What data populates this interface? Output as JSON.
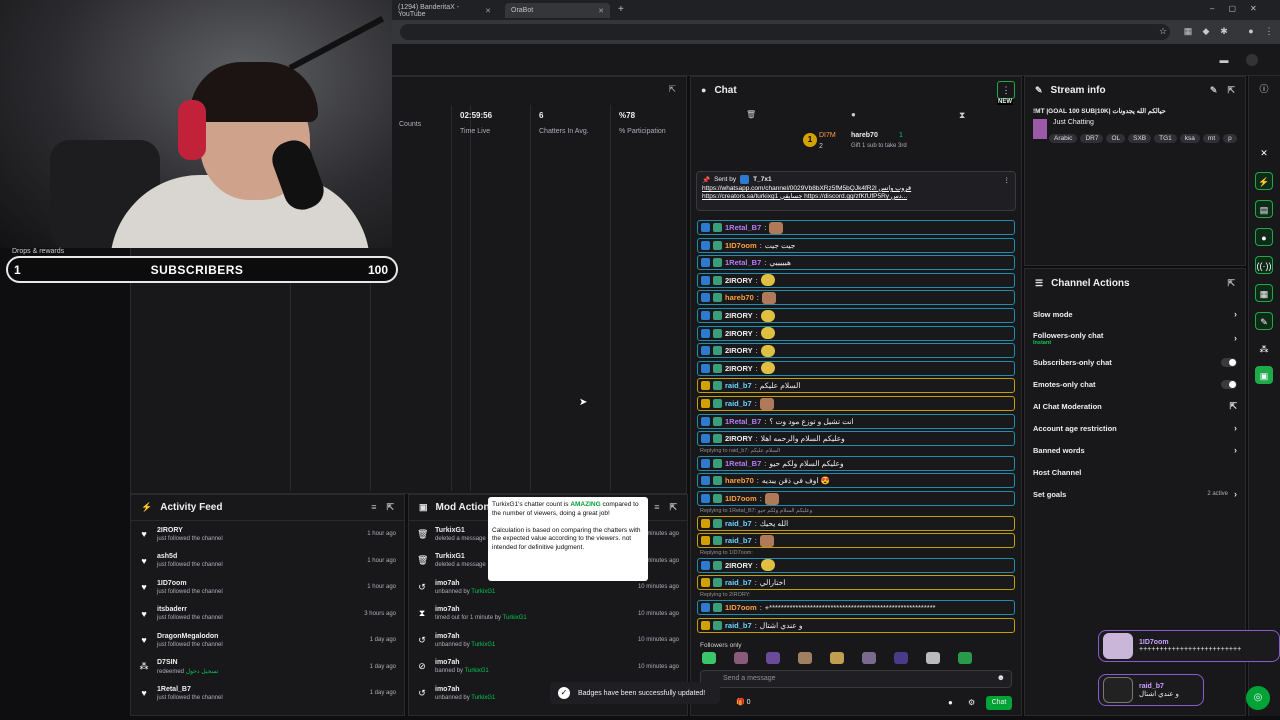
{
  "browser": {
    "tabs": [
      {
        "label": "(1294) BanderitaX - YouTube"
      },
      {
        "label": "OraBot"
      }
    ],
    "new_tab": "+"
  },
  "overlay": {
    "drops_label": "Drops & rewards",
    "goal_left": "1",
    "goal_title": "SUBSCRIBERS",
    "goal_right": "100"
  },
  "stats": {
    "columns": [
      {
        "value": "",
        "label": "Counts"
      },
      {
        "value": "02:59:56",
        "label": "Time Live"
      },
      {
        "value": "6",
        "label": "Chatters In Avg."
      },
      {
        "value": "%78",
        "label": "% Participation"
      }
    ]
  },
  "activity": {
    "title": "Activity Feed",
    "items": [
      {
        "icon": "heart-icon",
        "name": "2IRORY",
        "sub": "just followed the channel",
        "time": "1 hour ago"
      },
      {
        "icon": "heart-icon",
        "name": "ash5d",
        "sub": "just followed the channel",
        "time": "1 hour ago"
      },
      {
        "icon": "heart-icon",
        "name": "1ID7oom",
        "sub": "just followed the channel",
        "time": "1 hour ago"
      },
      {
        "icon": "heart-icon",
        "name": "itsbaderr",
        "sub": "just followed the channel",
        "time": "3 hours ago"
      },
      {
        "icon": "heart-icon",
        "name": "DragonMegalodon",
        "sub": "just followed the channel",
        "time": "1 day ago"
      },
      {
        "icon": "gift-icon",
        "name": "D7SIN",
        "sub": "redeemed",
        "sub2": "تسجيل دخول",
        "time": "1 day ago"
      },
      {
        "icon": "heart-icon",
        "name": "1Retal_B7",
        "sub": "just followed the channel",
        "time": "1 day ago"
      }
    ]
  },
  "mod": {
    "title": "Mod Action",
    "items": [
      {
        "icon": "trash-icon",
        "name": "TurkixG1",
        "sub": "deleted a message",
        "by": "",
        "time": "minutes ago"
      },
      {
        "icon": "trash-icon",
        "name": "TurkixG1",
        "sub": "deleted a message",
        "by": "",
        "time": "minutes ago"
      },
      {
        "icon": "undo-icon",
        "name": "imo7ah",
        "sub": "unbanned by",
        "by": "TurkixG1",
        "time": "10 minutes ago"
      },
      {
        "icon": "hourglass-icon",
        "name": "imo7ah",
        "sub": "timed out for 1 minute by",
        "by": "TurkixG1",
        "time": "10 minutes ago"
      },
      {
        "icon": "undo-icon",
        "name": "imo7ah",
        "sub": "unbanned by",
        "by": "TurkixG1",
        "time": "10 minutes ago"
      },
      {
        "icon": "ban-icon",
        "name": "imo7ah",
        "sub": "banned by",
        "by": "TurkixG1",
        "time": "10 minutes ago"
      },
      {
        "icon": "undo-icon",
        "name": "imo7ah",
        "sub": "unbanned by",
        "by": "TurkixG1",
        "time": "10 minutes ago"
      }
    ],
    "tooltip_p1_a": "TurkixG1's chatter count is ",
    "tooltip_p1_b": "AMAZING",
    "tooltip_p1_c": " compared to the number of viewers, doing a great job!",
    "tooltip_p2": "Calculation is based on comparing the chatters with the expected value according to the viewers. not intended for definitive judgment."
  },
  "chat": {
    "title": "Chat",
    "new_badge": "NEW",
    "leader_1": "DI7M",
    "leader_1_count": "2",
    "leader_2": "hareb70",
    "leader_2_count": "1",
    "leader_sub": "Gift 1 sub to take 3rd",
    "pinned_by": "Sent by",
    "pinned_user": "T_7x1",
    "pinned_line1": "https://whatsapp.com/channel/0029Vb8bXRz5fM5bQJk4fR2l قروب واتس",
    "pinned_line2": "https://creators.sa/turkixg1 جسابقي https://discord.gg/zfKfUfP5Ry دس...",
    "messages": [
      {
        "user": "1Retal_B7",
        "color": "#b77cf5",
        "text": "",
        "vip": false,
        "emote": true
      },
      {
        "user": "1ID7oom",
        "color": "#ff9f40",
        "text": "جيت جيت",
        "vip": false
      },
      {
        "user": "1Retal_B7",
        "color": "#b77cf5",
        "text": "هيييييي",
        "vip": false
      },
      {
        "user": "2IRORY",
        "color": "#efeff1",
        "text": "",
        "vip": false,
        "smile": true
      },
      {
        "user": "hareb70",
        "color": "#ff9f40",
        "text": "",
        "vip": false,
        "emote": true
      },
      {
        "user": "2IRORY",
        "color": "#efeff1",
        "text": "",
        "vip": false,
        "smile": true
      },
      {
        "user": "2IRORY",
        "color": "#efeff1",
        "text": "",
        "vip": false,
        "smile": true
      },
      {
        "user": "2IRORY",
        "color": "#efeff1",
        "text": "",
        "vip": false,
        "smile": true
      },
      {
        "user": "2IRORY",
        "color": "#efeff1",
        "text": "",
        "vip": false,
        "smile": true
      },
      {
        "user": "raid_b7",
        "color": "#6fd3ff",
        "text": "السلام عليكم",
        "vip": true
      },
      {
        "user": "raid_b7",
        "color": "#6fd3ff",
        "text": "",
        "vip": true,
        "emote": true
      },
      {
        "user": "1Retal_B7",
        "color": "#b77cf5",
        "text": "انت تشيل و توزع مود وت ؟",
        "vip": false
      },
      {
        "user": "2IRORY",
        "color": "#efeff1",
        "text": "وعليكم السلام والرحمه اهلا",
        "vip": false
      },
      {
        "user": "1Retal_B7",
        "color": "#b77cf5",
        "text": "وعليكم السلام ولكم حيو",
        "vip": false,
        "reply": "Replying to raid_b7: السلام عليكم"
      },
      {
        "user": "hareb70",
        "color": "#ff9f40",
        "text": "اوف في ذقن يبديه 😍",
        "vip": false
      },
      {
        "user": "1ID7oom",
        "color": "#ff9f40",
        "text": "",
        "vip": false,
        "emote": true
      },
      {
        "user": "raid_b7",
        "color": "#6fd3ff",
        "text": "الله يحيك",
        "vip": true,
        "reply": "Replying to 1Retal_B7: وعليكم السلام ولكم حيو"
      },
      {
        "user": "raid_b7",
        "color": "#6fd3ff",
        "text": "",
        "vip": true,
        "emote": true
      },
      {
        "user": "2IRORY",
        "color": "#efeff1",
        "text": "",
        "vip": false,
        "smile": true,
        "reply": "Replying to 1ID7oom:"
      },
      {
        "user": "raid_b7",
        "color": "#6fd3ff",
        "text": "اختارالي",
        "vip": true
      },
      {
        "user": "1ID7oom",
        "color": "#ff9f40",
        "text": "+*********************************************************",
        "vip": false,
        "reply": "Replying to 2IRORY:"
      },
      {
        "user": "raid_b7",
        "color": "#6fd3ff",
        "text": "و عندي اشتال",
        "vip": true
      }
    ],
    "followers_only": "Followers only",
    "input_placeholder": "Send a message",
    "points": "0",
    "send_label": "Chat"
  },
  "stream_info": {
    "title": "Stream info",
    "stream_title": "!MT |GOAL 100 SUB|10K| حيالكم الله يجدونات",
    "category": "Just Chatting",
    "tags": [
      "Arabic",
      "DR7",
      "OL",
      "SXB",
      "TG1",
      "ksa",
      "mt",
      "p"
    ]
  },
  "channel_actions": {
    "title": "Channel Actions",
    "items": [
      {
        "label": "Slow mode",
        "control": "chevron"
      },
      {
        "label": "Followers-only chat",
        "sub": "Instant",
        "control": "chevron"
      },
      {
        "label": "Subscribers-only chat",
        "control": "toggle"
      },
      {
        "label": "Emotes-only chat",
        "control": "toggle"
      },
      {
        "label": "AI Chat Moderation",
        "control": "external"
      },
      {
        "label": "Account age restriction",
        "control": "chevron"
      },
      {
        "label": "Banned words",
        "control": "chevron"
      },
      {
        "label": "Host Channel",
        "control": "none"
      },
      {
        "label": "Set goals",
        "control": "chevron",
        "extra": "2 active"
      }
    ]
  },
  "alerts": [
    {
      "user": "1ID7oom",
      "text": "+++++++++++++++++++++++++"
    },
    {
      "user": "raid_b7",
      "text": "و عندي اشتال"
    }
  ],
  "toast": "Badges have been successfully updated!",
  "colors": {
    "accent_green": "#00c853",
    "vip_gold": "#c59e00",
    "mod_blue": "#1f8fb0"
  }
}
